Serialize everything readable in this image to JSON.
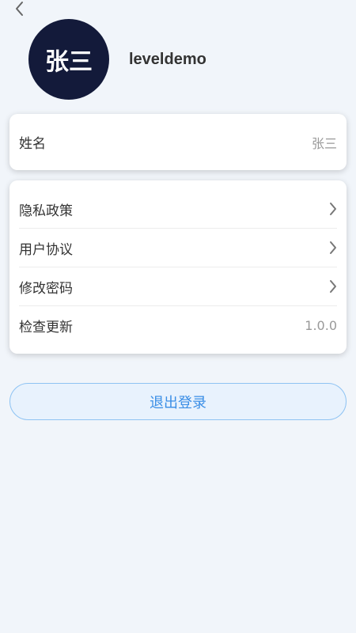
{
  "header": {
    "back_icon": "chevron-left-icon"
  },
  "profile": {
    "avatar_text": "张三",
    "avatar_color": "#131a3a",
    "username": "leveldemo"
  },
  "info_card": {
    "name_label": "姓名",
    "name_value": "张三"
  },
  "menu": {
    "items": [
      {
        "label": "隐私政策",
        "icon": "chevron-right-icon"
      },
      {
        "label": "用户协议",
        "icon": "chevron-right-icon"
      },
      {
        "label": "修改密码",
        "icon": "chevron-right-icon"
      },
      {
        "label": "检查更新",
        "value": "1.0.0"
      }
    ]
  },
  "logout": {
    "label": "退出登录",
    "accent_color": "#3a8ee6"
  }
}
